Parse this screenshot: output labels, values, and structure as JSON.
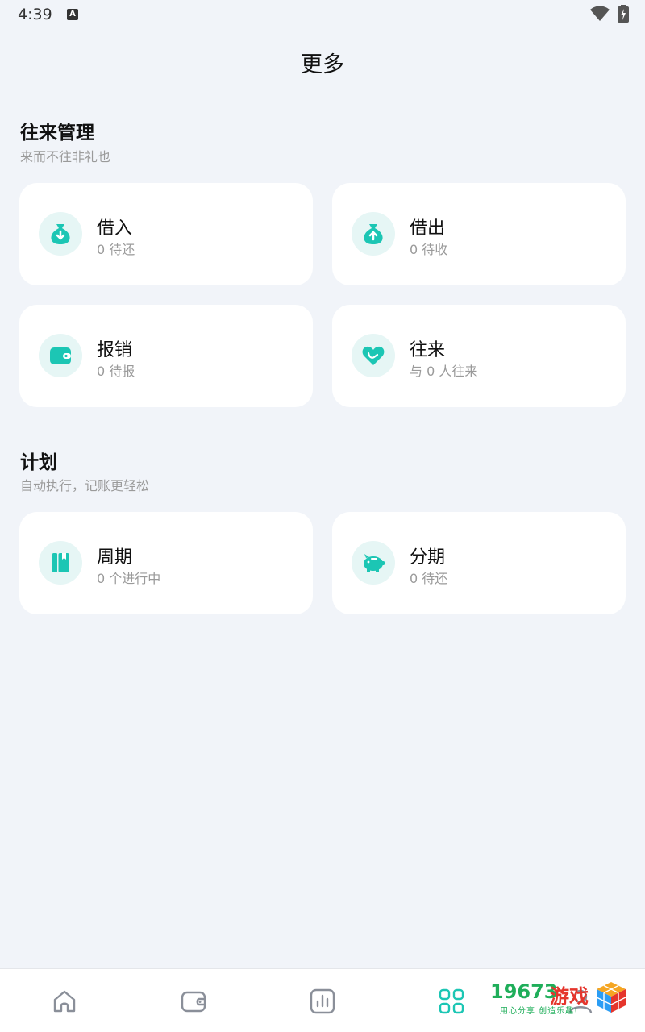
{
  "status_bar": {
    "time": "4:39",
    "notification_icon": "A"
  },
  "page": {
    "title": "更多"
  },
  "sections": [
    {
      "title": "往来管理",
      "subtitle": "来而不往非礼也",
      "cards": [
        {
          "icon": "money-bag-down-icon",
          "title": "借入",
          "subtitle": "0 待还"
        },
        {
          "icon": "money-bag-up-icon",
          "title": "借出",
          "subtitle": "0 待收"
        },
        {
          "icon": "wallet-icon",
          "title": "报销",
          "subtitle": "0 待报"
        },
        {
          "icon": "heart-hand-icon",
          "title": "往来",
          "subtitle": "与 0 人往来"
        }
      ]
    },
    {
      "title": "计划",
      "subtitle": "自动执行，记账更轻松",
      "cards": [
        {
          "icon": "book-icon",
          "title": "周期",
          "subtitle": "0 个进行中"
        },
        {
          "icon": "piggy-bank-icon",
          "title": "分期",
          "subtitle": "0 待还"
        }
      ]
    }
  ],
  "bottom_nav": [
    {
      "icon": "home-icon",
      "active": false
    },
    {
      "icon": "wallet-icon",
      "active": false
    },
    {
      "icon": "chart-icon",
      "active": false
    },
    {
      "icon": "grid-icon",
      "active": true
    },
    {
      "icon": "person-icon",
      "active": false
    }
  ],
  "watermark": {
    "number": "19673",
    "brand": "游戏",
    "tagline": "用心分享 创造乐趣!"
  },
  "colors": {
    "accent": "#1cc6b4",
    "icon_bg": "#e6f6f5",
    "background": "#f1f4f9",
    "card": "#ffffff",
    "nav_icon": "#8a8f99"
  }
}
